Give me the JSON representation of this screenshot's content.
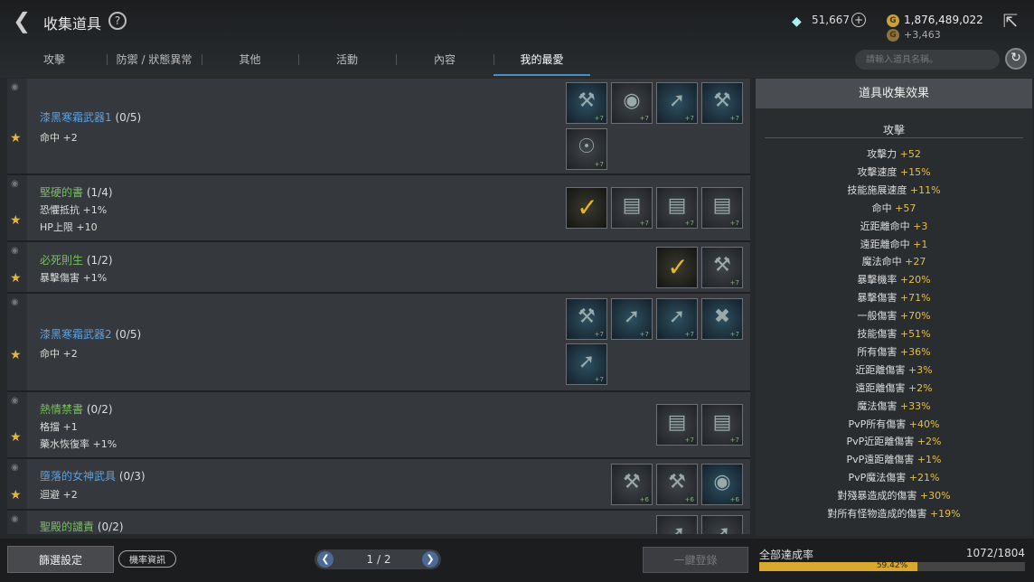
{
  "header": {
    "title": "收集道具",
    "help": "?",
    "back_icon": "back-arrow-icon",
    "gem_count": "51,667",
    "gem_plus": "+",
    "gold": "1,876,489,022",
    "gold_sub": "+3,463",
    "exit_icon": "exit-icon"
  },
  "tabs": [
    "攻擊",
    "防禦 / 狀態異常",
    "其他",
    "活動",
    "內容",
    "我的最愛"
  ],
  "selected_tab": 5,
  "search": {
    "placeholder": "請輸入道具名稱。"
  },
  "collections": [
    {
      "name": "漆黑寒霜武器1",
      "count": "(0/5)",
      "color": "blue",
      "stats": [
        "命中 +2"
      ],
      "slots": [
        "+7",
        "+7",
        "+7",
        "+7",
        "+7"
      ]
    },
    {
      "name": "堅硬的書",
      "count": "(1/4)",
      "color": "green",
      "stats": [
        "恐懼抵抗 +1%",
        "HP上限 +10"
      ],
      "slots": [
        "check",
        "+7",
        "+7",
        "+7"
      ]
    },
    {
      "name": "必死則生",
      "count": "(1/2)",
      "color": "green",
      "stats": [
        "暴擊傷害 +1%"
      ],
      "slots": [
        "check",
        "+7"
      ]
    },
    {
      "name": "漆黑寒霜武器2",
      "count": "(0/5)",
      "color": "blue",
      "stats": [
        "命中 +2"
      ],
      "slots": [
        "+7",
        "+7",
        "+7",
        "+7",
        "+7"
      ]
    },
    {
      "name": "熱情禁書",
      "count": "(0/2)",
      "color": "green",
      "stats": [
        "格擋 +1",
        "藥水恢復率 +1%"
      ],
      "slots": [
        "+7",
        "+7"
      ]
    },
    {
      "name": "墮落的女神武具",
      "count": "(0/3)",
      "color": "blue",
      "stats": [
        "迴避 +2"
      ],
      "slots": [
        "+6",
        "+6",
        "+6"
      ]
    },
    {
      "name": "聖殿的譴責",
      "count": "(0/2)",
      "color": "green",
      "stats": [],
      "slots": [
        "",
        ""
      ]
    }
  ],
  "panel": {
    "title": "道具收集效果",
    "category": "攻擊",
    "items": [
      {
        "label": "攻擊力",
        "value": "+52"
      },
      {
        "label": "攻擊速度",
        "value": "+15%"
      },
      {
        "label": "技能施展速度",
        "value": "+11%"
      },
      {
        "label": "命中",
        "value": "+57"
      },
      {
        "label": "近距離命中",
        "value": "+3"
      },
      {
        "label": "遠距離命中",
        "value": "+1"
      },
      {
        "label": "魔法命中",
        "value": "+27"
      },
      {
        "label": "暴擊機率",
        "value": "+20%"
      },
      {
        "label": "暴擊傷害",
        "value": "+71%"
      },
      {
        "label": "一般傷害",
        "value": "+70%"
      },
      {
        "label": "技能傷害",
        "value": "+51%"
      },
      {
        "label": "所有傷害",
        "value": "+36%"
      },
      {
        "label": "近距離傷害",
        "value": "+3%"
      },
      {
        "label": "遠距離傷害",
        "value": "+2%"
      },
      {
        "label": "魔法傷害",
        "value": "+33%"
      },
      {
        "label": "PvP所有傷害",
        "value": "+40%"
      },
      {
        "label": "PvP近距離傷害",
        "value": "+2%"
      },
      {
        "label": "PvP遠距離傷害",
        "value": "+1%"
      },
      {
        "label": "PvP魔法傷害",
        "value": "+21%"
      },
      {
        "label": "對殘暴造成的傷害",
        "value": "+30%"
      },
      {
        "label": "對所有怪物造成的傷害",
        "value": "+19%"
      }
    ]
  },
  "footer": {
    "filter": "篩選設定",
    "rate": "機率資訊",
    "page": "1 / 2",
    "register_all": "一鍵登錄",
    "total_label": "全部達成率",
    "total_value": "1072/1804",
    "percent": "59.42%",
    "percent_value": 59.42
  },
  "colors": {
    "accent_gold": "#e4c04a",
    "blue_name": "#5ea0e0",
    "green_name": "#78c060",
    "progress": "#d8a830"
  }
}
